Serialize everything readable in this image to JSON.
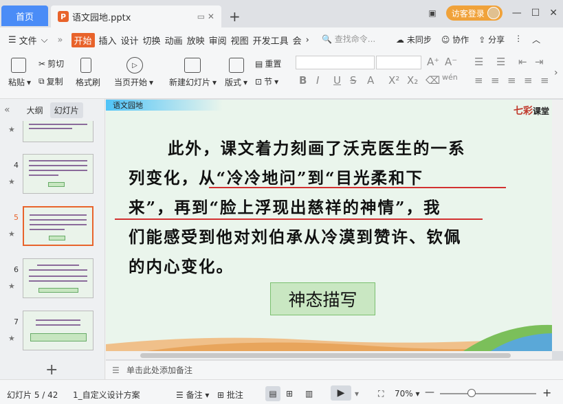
{
  "tabs": {
    "home": "首页",
    "doc": "语文园地.pptx"
  },
  "visitor_login": "访客登录",
  "menu": {
    "file": "文件",
    "start": "开始",
    "items": [
      "插入",
      "设计",
      "切换",
      "动画",
      "放映",
      "审阅",
      "视图",
      "开发工具",
      "会"
    ],
    "search_placeholder": "查找命令...",
    "unsynced": "未同步",
    "collab": "协作",
    "share": "分享"
  },
  "ribbon": {
    "paste": "粘贴",
    "cut": "剪切",
    "copy": "复制",
    "format_painter": "格式刷",
    "from_current": "当页开始",
    "new_slide": "新建幻灯片",
    "layout": "版式",
    "reset": "重置",
    "section": "节"
  },
  "panel": {
    "outline": "大纲",
    "slides": "幻灯片",
    "numbers": [
      "4",
      "5",
      "6",
      "7"
    ]
  },
  "slide": {
    "title_bar": "语文园地",
    "logo_a": "七彩",
    "logo_b": "课堂",
    "lines": [
      "此外，课文着力刻画了沃克医生的一系",
      "列变化，从“冷冷地问”到“目光柔和下",
      "来”，再到“脸上浮现出慈祥的神情”，我",
      "们能感受到他对刘伯承从冷漠到赞许、钦佩",
      "的内心变化。"
    ],
    "tag": "神态描写"
  },
  "notes_placeholder": "单击此处添加备注",
  "status": {
    "slide_pos": "幻灯片 5 / 42",
    "theme": "1_自定义设计方案",
    "notes": "备注",
    "comments": "批注",
    "zoom": "70%"
  },
  "colors": {
    "accent": "#e8632b",
    "home_tab": "#4a8cf7",
    "underline": "#d23030"
  }
}
